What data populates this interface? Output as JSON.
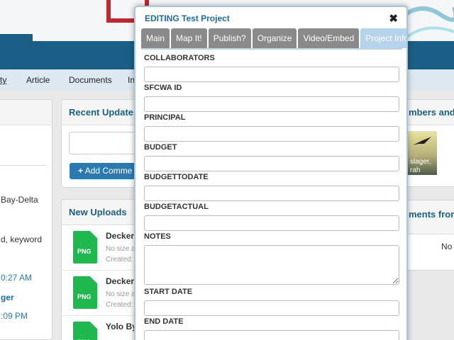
{
  "nav": {
    "items": [
      "ty",
      "Article",
      "Documents",
      "In"
    ]
  },
  "recent_updates": {
    "title": "Recent Updates",
    "add_comment_label": "Add Comme"
  },
  "left_panel": {
    "lines": [
      "Bay-Delta",
      "d, keyword",
      "0:27 AM",
      "ger",
      ":09 PM"
    ]
  },
  "new_uploads": {
    "title": "New Uploads",
    "items": [
      {
        "name": "Decker",
        "meta1": "No size a",
        "meta2": "Created:",
        "type": "PNG"
      },
      {
        "name": "Decker",
        "meta1": "No size a",
        "meta2": "Created:",
        "type": "PNG"
      },
      {
        "name": "Yolo By",
        "meta1": "",
        "meta2": "",
        "type": "PNG"
      }
    ]
  },
  "right_panels": {
    "members_title": "mbers and Fo",
    "photo_caption1": "slager,",
    "photo_caption2": "rah",
    "comments_title": "ments from",
    "comments_empty": "No c"
  },
  "modal": {
    "title": "EDITING Test Project",
    "close_icon": "close-icon",
    "tabs": [
      {
        "label": "Main",
        "active": false
      },
      {
        "label": "Map It!",
        "active": false
      },
      {
        "label": "Publish?",
        "active": false
      },
      {
        "label": "Organize",
        "active": false
      },
      {
        "label": "Video/Embed",
        "active": false
      },
      {
        "label": "Project Info",
        "active": true
      }
    ],
    "fields": {
      "collaborators": {
        "label": "COLLABORATORS",
        "value": ""
      },
      "sfcwa_id": {
        "label": "SFCWA ID",
        "value": ""
      },
      "principal": {
        "label": "PRINCIPAL",
        "value": ""
      },
      "budget": {
        "label": "BUDGET",
        "value": ""
      },
      "budgettodate": {
        "label": "BUDGETTODATE",
        "value": ""
      },
      "budgetactual": {
        "label": "BUDGETACTUAL",
        "value": ""
      },
      "notes": {
        "label": "NOTES",
        "value": ""
      },
      "start_date": {
        "label": "START DATE",
        "value": ""
      },
      "end_date": {
        "label": "END DATE",
        "value": ""
      }
    }
  },
  "colors": {
    "header_band": "#1b5f87",
    "modal_title": "#1b6aa5",
    "tab_inactive": "#8a8a8a",
    "tab_active": "#b6d3ec",
    "png_green": "#1fb84f"
  }
}
